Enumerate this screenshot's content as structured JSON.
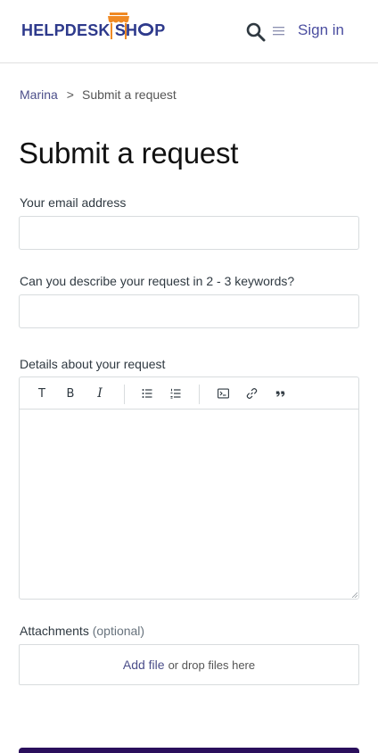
{
  "header": {
    "logo_text_before": "HELPDESK SH",
    "logo_text_after": "P",
    "signin_label": "Sign in",
    "brand_color": "#2e3a8c",
    "accent_color": "#f08a24"
  },
  "breadcrumb": {
    "items": [
      "Marina",
      "Submit a request"
    ],
    "separator": ">"
  },
  "page_title": "Submit a request",
  "form": {
    "email_label": "Your email address",
    "email_value": "",
    "keywords_label": "Can you describe your request in 2 - 3 keywords?",
    "keywords_value": "",
    "details_label": "Details about your request",
    "details_value": "",
    "toolbar": {
      "text_label": "T",
      "bold_label": "B",
      "italic_label": "I",
      "icons": [
        "bulleted-list-icon",
        "numbered-list-icon",
        "code-block-icon",
        "link-icon",
        "quote-icon"
      ]
    },
    "attachments_label": "Attachments",
    "attachments_optional": "(optional)",
    "add_file_label": "Add file",
    "drop_text": "or drop files here"
  },
  "submit_color": "#2a0f5c"
}
